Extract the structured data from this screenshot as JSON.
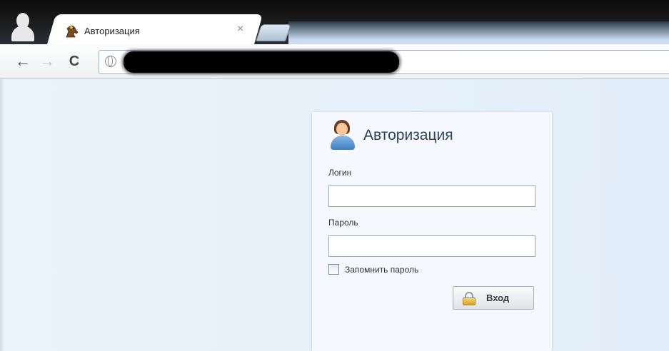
{
  "browser": {
    "tab": {
      "title": "Авторизация",
      "close_icon": "×",
      "favicon": "horse-head-icon"
    },
    "toolbar": {
      "back_icon": "←",
      "forward_icon": "→",
      "reload_icon": "C"
    }
  },
  "login": {
    "title": "Авторизация",
    "login_label": "Логин",
    "login_value": "",
    "password_label": "Пароль",
    "password_value": "",
    "remember_label": "Запомнить пароль",
    "remember_checked": false,
    "submit_label": "Вход"
  },
  "colors": {
    "page_bg": "#e4effa",
    "title_text": "#2e3f58"
  }
}
